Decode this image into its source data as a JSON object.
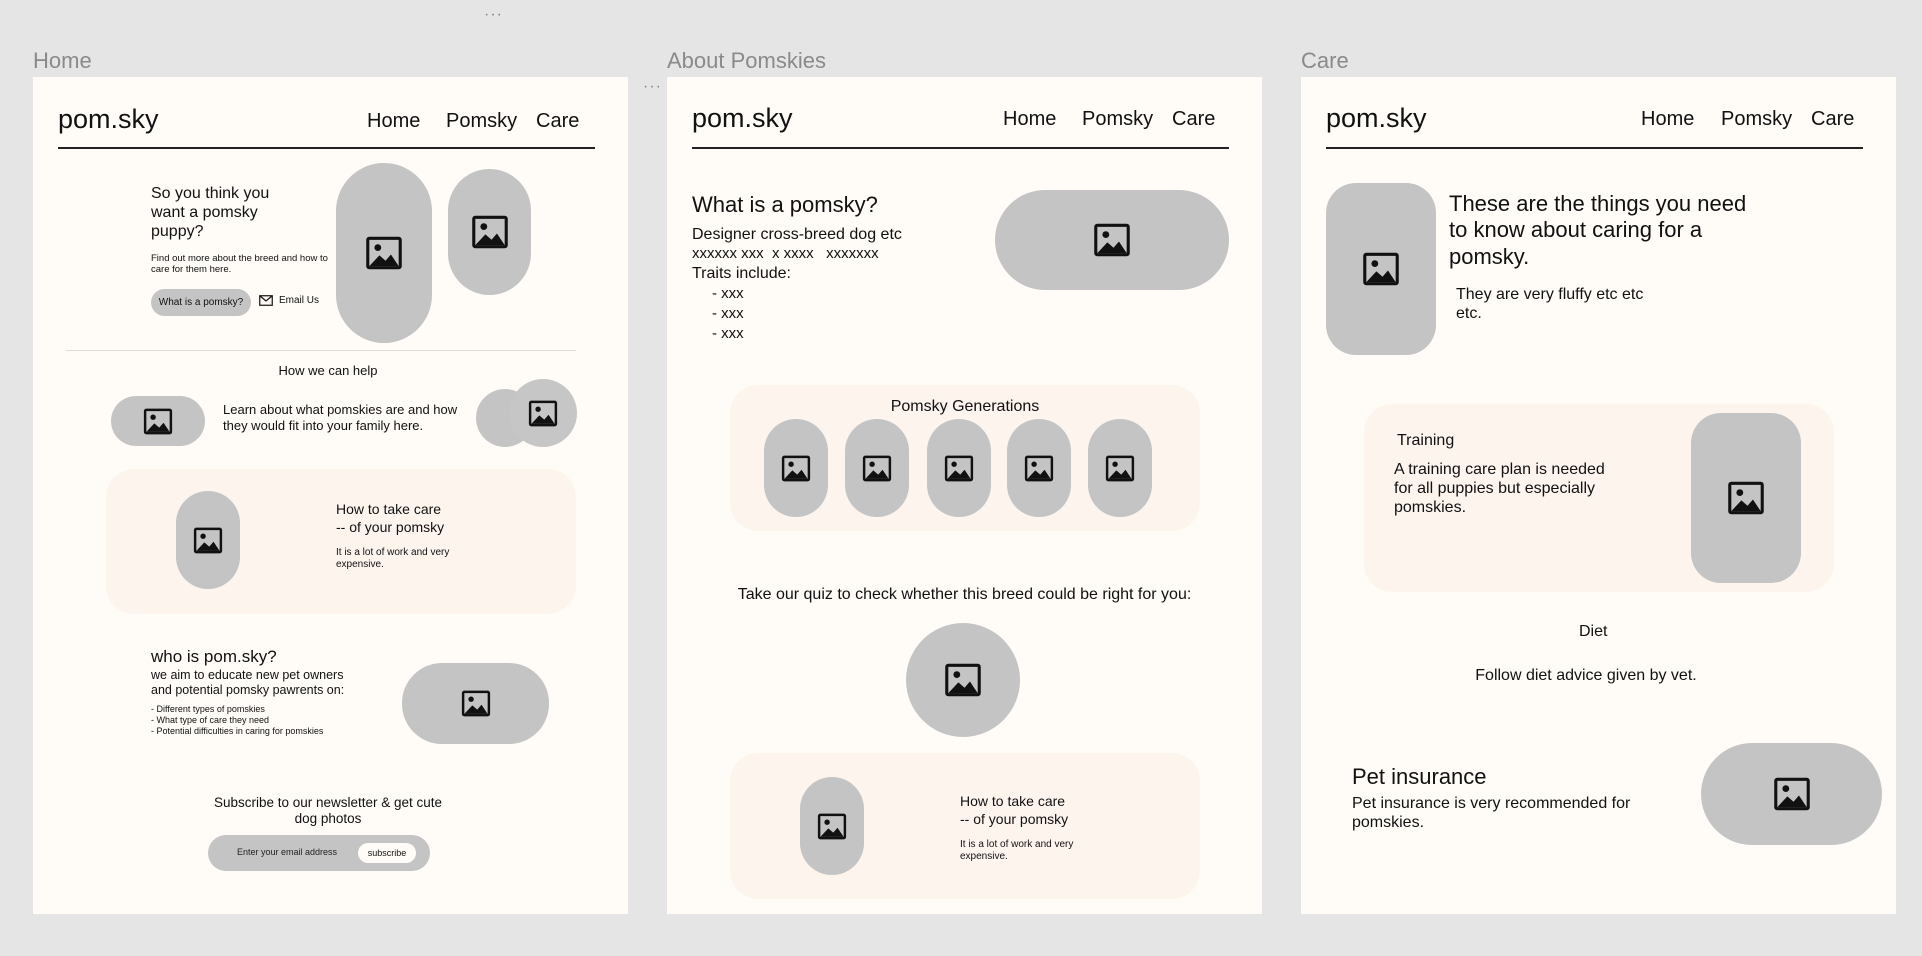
{
  "canvas": {
    "top_dots": "···",
    "mid_dots": "···",
    "frames": [
      "Home",
      "About Pomskies",
      "Care"
    ]
  },
  "site": {
    "logo": "pom.sky",
    "nav": [
      "Home",
      "Pomsky",
      "Care"
    ]
  },
  "icons": {
    "image": "image-placeholder-icon",
    "email": "envelope-icon"
  },
  "colors": {
    "canvas": "#e5e5e5",
    "page": "#fffcf7",
    "panel": "#fdf4ee",
    "placeholder": "#c4c4c4"
  },
  "home": {
    "hero_title": "So you think you want a pomsky puppy?",
    "hero_text": "Find out more about the breed and how to care for them here.",
    "hero_button": "What is a pomsky?",
    "email_link": "Email Us",
    "help_heading": "How we can help",
    "help_text": "Learn about what pomskies are and how they would fit into your family here.",
    "care_title_1": "How to take care",
    "care_title_2": "-- of your pomsky",
    "care_text": "It is a lot of work and very expensive.",
    "who_title": "who is pom.sky?",
    "who_text": "we aim to educate new pet owners and potential pomsky pawrents on:",
    "who_list": [
      "- Different types of pomskies",
      "- What type of care they need",
      "- Potential difficulties in caring for pomskies"
    ],
    "newsletter_title": "Subscribe to our newsletter & get cute dog photos",
    "email_placeholder": "Enter your email address",
    "subscribe_button": "subscribe"
  },
  "about": {
    "title": "What is a pomsky?",
    "line1": "Designer cross-breed dog etc",
    "line2": "xxxxxx xxx  x xxxx   xxxxxxx",
    "traits_label": "Traits include:",
    "traits": [
      "- xxx",
      "- xxx",
      "- xxx"
    ],
    "generations_heading": "Pomsky Generations",
    "quiz_text": "Take our quiz to check whether this breed could be right for you:",
    "care_title_1": "How to take care",
    "care_title_2": "-- of your pomsky",
    "care_text": "It is a lot of work and very expensive."
  },
  "care": {
    "title": "These are the things you need to know about caring for a pomsky.",
    "subtitle": "They are very fluffy etc etc etc.",
    "training_heading": "Training",
    "training_text": "A training care plan is needed for all puppies but especially pomskies.",
    "diet_heading": "Diet",
    "diet_text": "Follow diet advice given by vet.",
    "insurance_heading": "Pet insurance",
    "insurance_text": "Pet insurance is very recommended for pomskies."
  }
}
